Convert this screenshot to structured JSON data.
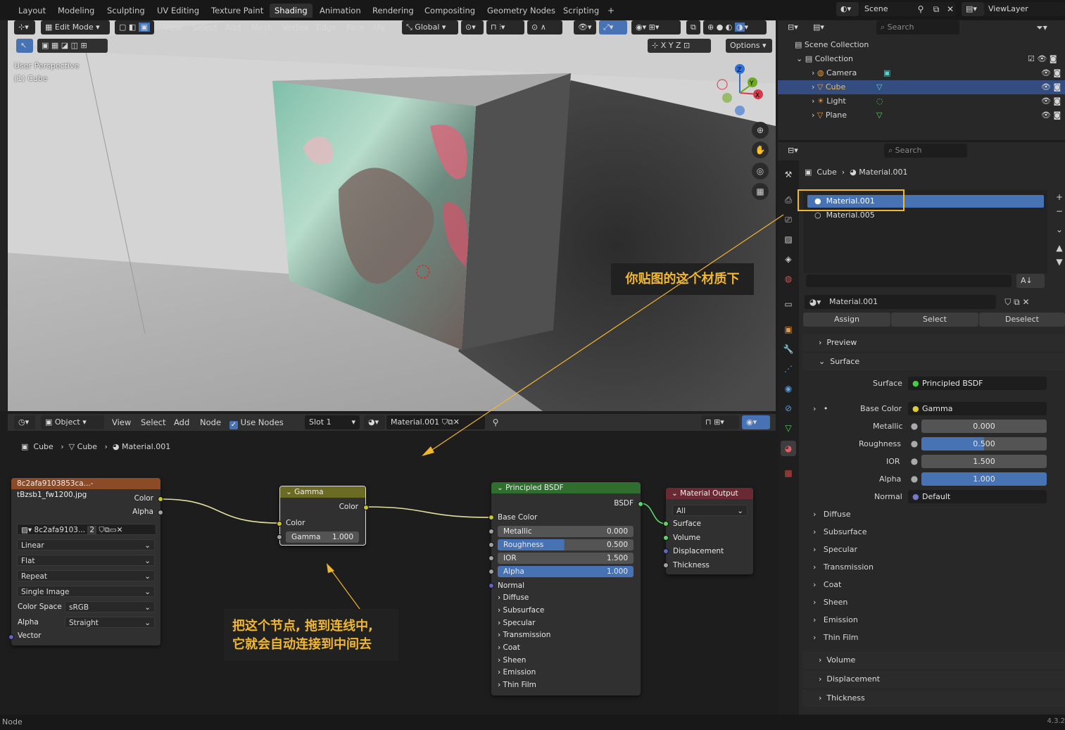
{
  "workspace_tabs": [
    "Layout",
    "Modeling",
    "Sculpting",
    "UV Editing",
    "Texture Paint",
    "Shading",
    "Animation",
    "Rendering",
    "Compositing",
    "Geometry Nodes",
    "Scripting"
  ],
  "active_tab": "Shading",
  "scene": {
    "label": "Scene",
    "view_layer": "ViewLayer"
  },
  "viewport": {
    "mode": "Edit Mode",
    "menus": [
      "View",
      "Select",
      "Add",
      "Mesh",
      "Vertex",
      "Edge",
      "Face",
      "UV"
    ],
    "transform_orientation": "Global",
    "options_label": "Options",
    "axes": [
      "X",
      "Y",
      "Z"
    ],
    "overlay_line1": "User Perspective",
    "overlay_line2": "(1) Cube",
    "gizmo": {
      "x": "X",
      "y": "Y",
      "z": "Z"
    }
  },
  "outliner": {
    "search_placeholder": "Search",
    "scene_collection": "Scene Collection",
    "collection": "Collection",
    "items": [
      {
        "name": "Camera",
        "selected": false
      },
      {
        "name": "Cube",
        "selected": true
      },
      {
        "name": "Light",
        "selected": false
      },
      {
        "name": "Plane",
        "selected": false
      }
    ]
  },
  "properties": {
    "search_placeholder": "Search",
    "breadcrumb_object": "Cube",
    "breadcrumb_material": "Material.001",
    "slots": [
      "Material.001",
      "Material.005"
    ],
    "material_name": "Material.001",
    "assign": "Assign",
    "select": "Select",
    "deselect": "Deselect",
    "preview": "Preview",
    "surface_section": "Surface",
    "surface_label": "Surface",
    "surface_value": "Principled BSDF",
    "base_color_label": "Base Color",
    "base_color_value": "Gamma",
    "metallic_label": "Metallic",
    "metallic_value": "0.000",
    "roughness_label": "Roughness",
    "roughness_value": "0.500",
    "ior_label": "IOR",
    "ior_value": "1.500",
    "alpha_label": "Alpha",
    "alpha_value": "1.000",
    "normal_label": "Normal",
    "normal_value": "Default",
    "subpanels": [
      "Diffuse",
      "Subsurface",
      "Specular",
      "Transmission",
      "Coat",
      "Sheen",
      "Emission",
      "Thin Film"
    ],
    "bottom_sections": [
      "Volume",
      "Displacement",
      "Thickness"
    ]
  },
  "node_editor": {
    "mode": "Object",
    "menus": [
      "View",
      "Select",
      "Add",
      "Node"
    ],
    "use_nodes": "Use Nodes",
    "slot": "Slot 1",
    "material": "Material.001",
    "breadcrumb": [
      "Cube",
      "Cube",
      "Material.001"
    ],
    "image_node": {
      "title": "8c2afa9103853ca...-tBzsb1_fw1200.jpg",
      "out_color": "Color",
      "out_alpha": "Alpha",
      "image_name": "8c2afa9103...",
      "users": "2",
      "interpolation": "Linear",
      "projection": "Flat",
      "extension": "Repeat",
      "source": "Single Image",
      "color_space_label": "Color Space",
      "color_space": "sRGB",
      "alpha_label": "Alpha",
      "alpha_mode": "Straight",
      "vector": "Vector"
    },
    "gamma_node": {
      "title": "Gamma",
      "out_color": "Color",
      "in_color": "Color",
      "gamma_label": "Gamma",
      "gamma_value": "1.000"
    },
    "bsdf_node": {
      "title": "Principled BSDF",
      "out": "BSDF",
      "base_color": "Base Color",
      "metallic": "Metallic",
      "metallic_value": "0.000",
      "roughness": "Roughness",
      "roughness_value": "0.500",
      "ior": "IOR",
      "ior_value": "1.500",
      "alpha": "Alpha",
      "alpha_value": "1.000",
      "normal": "Normal",
      "panels": [
        "Diffuse",
        "Subsurface",
        "Specular",
        "Transmission",
        "Coat",
        "Sheen",
        "Emission",
        "Thin Film"
      ]
    },
    "output_node": {
      "title": "Material Output",
      "target": "All",
      "inputs": [
        "Surface",
        "Volume",
        "Displacement",
        "Thickness"
      ]
    }
  },
  "callouts": {
    "material": "你贴图的这个材质下",
    "node_line1": "把这个节点, 拖到连线中,",
    "node_line2": "它就会自动连接到中间去"
  },
  "status": {
    "left": "Node",
    "version": "4.3.2"
  },
  "colors": {
    "accent": "#4772b3",
    "callout": "#f2b730",
    "selected_outline": "#f2b730"
  }
}
